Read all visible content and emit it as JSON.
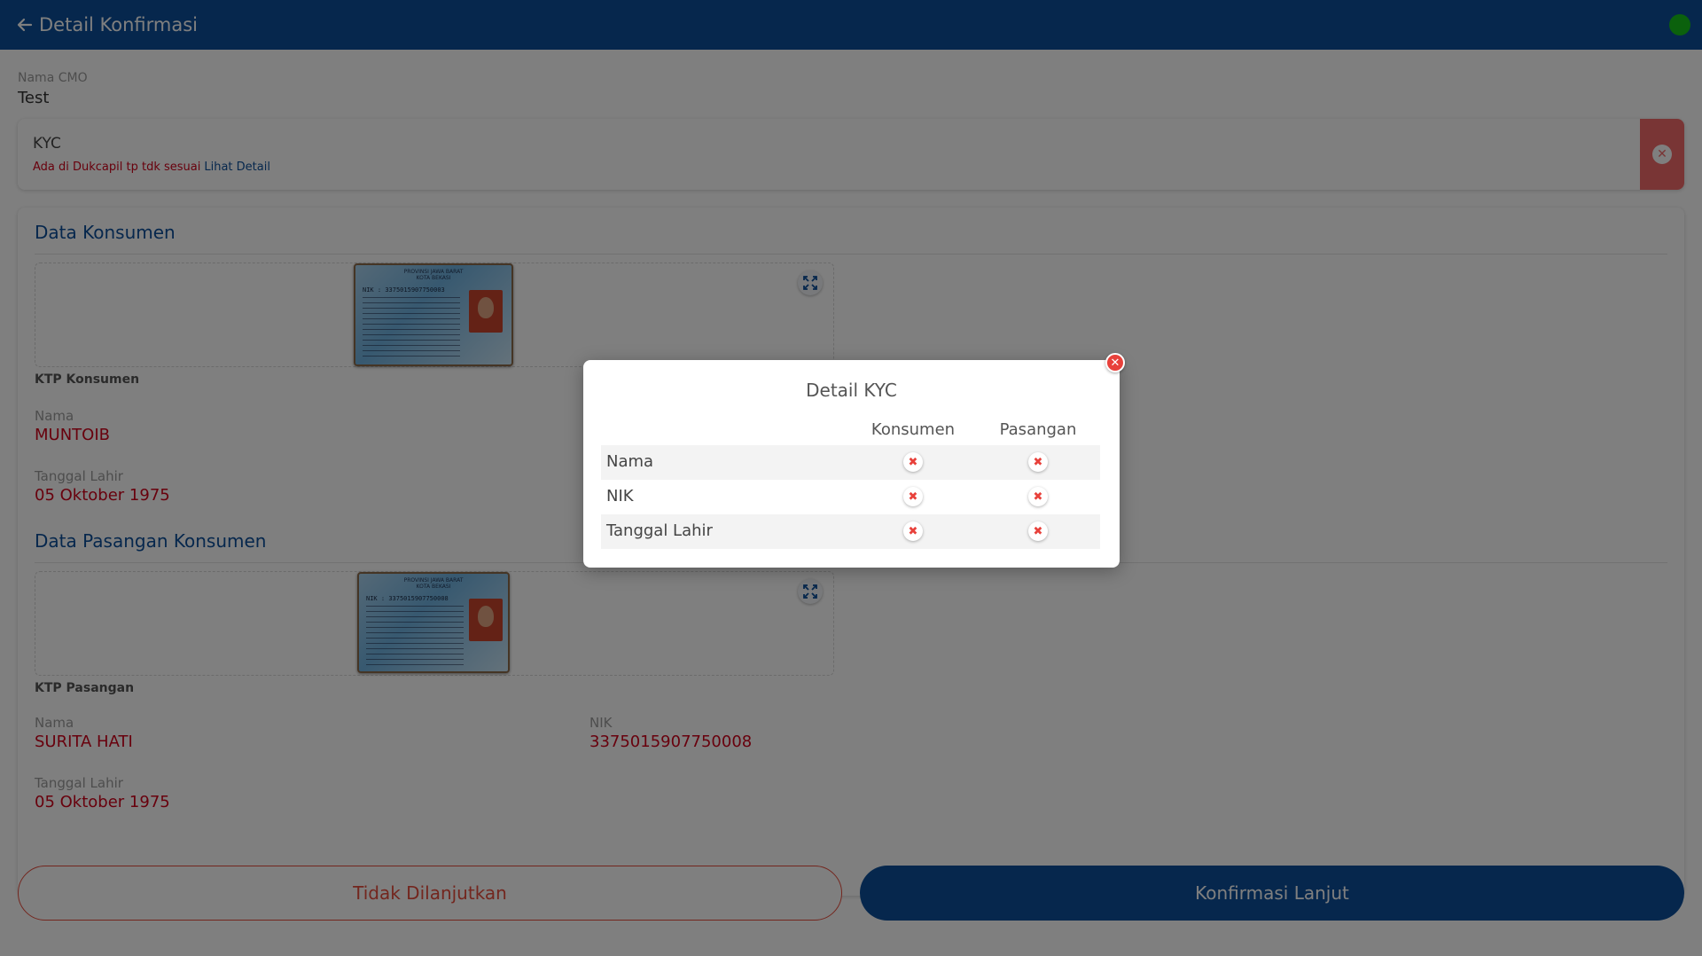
{
  "header": {
    "back_icon": "arrow-left-icon",
    "title": "Detail Konfirmasi",
    "status_color": "#17c21a"
  },
  "cmo": {
    "label": "Nama CMO",
    "value": "Test"
  },
  "kyc": {
    "title": "KYC",
    "status_text": "Ada di Dukcapil tp tdk sesuai",
    "link_text": "Lihat Detail",
    "status_icon": "close-circle-icon"
  },
  "consumer": {
    "section_title": "Data Konsumen",
    "ktp_label": "KTP Konsumen",
    "ktp_nik_text": "3375015907750003",
    "name_label": "Nama",
    "name_value": "MUNTOIB",
    "dob_label": "Tanggal Lahir",
    "dob_value": "05 Oktober 1975"
  },
  "spouse": {
    "section_title": "Data Pasangan Konsumen",
    "ktp_label": "KTP Pasangan",
    "ktp_nik_text": "3375015907750008",
    "name_label": "Nama",
    "name_value": "SURITA HATI",
    "nik_label": "NIK",
    "nik_value": "3375015907750008",
    "dob_label": "Tanggal Lahir",
    "dob_value": "05 Oktober 1975"
  },
  "ktp_card": {
    "header_line1": "PROVINSI JAWA BARAT",
    "header_line2": "KOTA BEKASI",
    "nik_prefix": "NIK"
  },
  "buttons": {
    "reject_label": "Tidak Dilanjutkan",
    "confirm_label": "Konfirmasi Lanjut"
  },
  "modal": {
    "title": "Detail KYC",
    "columns": [
      "Konsumen",
      "Pasangan"
    ],
    "rows": [
      {
        "label": "Nama",
        "konsumen": "not-match",
        "pasangan": "not-match"
      },
      {
        "label": "NIK",
        "konsumen": "not-match",
        "pasangan": "not-match"
      },
      {
        "label": "Tanggal Lahir",
        "konsumen": "not-match",
        "pasangan": "not-match"
      }
    ],
    "mismatch_color": "#e8413b"
  }
}
